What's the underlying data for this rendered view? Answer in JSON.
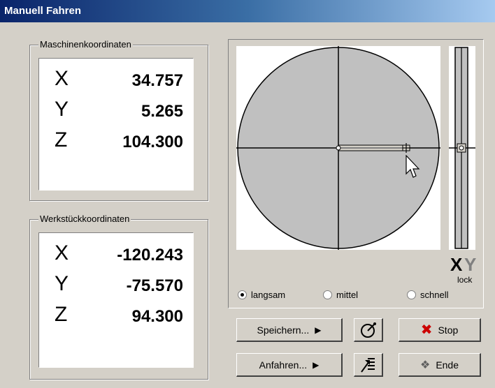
{
  "window": {
    "title": "Manuell Fahren"
  },
  "machine": {
    "legend": "Maschinenkoordinaten",
    "rows": [
      {
        "axis": "X",
        "value": "34.757"
      },
      {
        "axis": "Y",
        "value": "5.265"
      },
      {
        "axis": "Z",
        "value": "104.300"
      }
    ]
  },
  "workpiece": {
    "legend": "Werkstückkoordinaten",
    "rows": [
      {
        "axis": "X",
        "value": "-120.243"
      },
      {
        "axis": "Y",
        "value": "-75.570"
      },
      {
        "axis": "Z",
        "value": "94.300"
      }
    ]
  },
  "jog": {
    "lock_x": "X",
    "lock_y": "Y",
    "lock_label": "lock"
  },
  "speed": {
    "options": [
      {
        "label": "langsam",
        "selected": true
      },
      {
        "label": "mittel",
        "selected": false
      },
      {
        "label": "schnell",
        "selected": false
      }
    ]
  },
  "buttons": {
    "save": "Speichern...",
    "approach": "Anfahren...",
    "stop": "Stop",
    "end": "Ende"
  },
  "colors": {
    "stop_icon": "#cc0000",
    "title_bar": "#0a246a",
    "disc": "#c0c0c0"
  }
}
